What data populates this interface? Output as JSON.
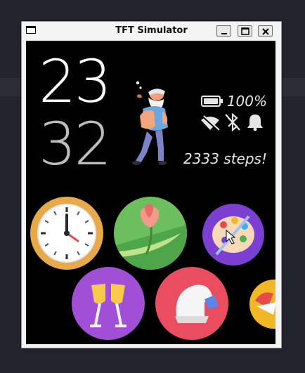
{
  "window": {
    "title": "TFT Simulator",
    "minimize_label": "minimize",
    "maximize_label": "maximize",
    "close_label": "close"
  },
  "watchface": {
    "hour": "23",
    "minute": "32",
    "battery_percent": "100%",
    "steps_text": "2333 steps!",
    "status_icons": [
      "wifi-off-icon",
      "bluetooth-off-icon",
      "bell-icon"
    ]
  },
  "apps": [
    {
      "name": "clock-app",
      "icon": "clock-icon",
      "bg": "#e7a94a"
    },
    {
      "name": "tulip-app",
      "icon": "tulip-icon",
      "bg": "#6cbf5c"
    },
    {
      "name": "paint-app",
      "icon": "palette-icon",
      "bg": "#7b3fd1"
    },
    {
      "name": "champagne-app",
      "icon": "champagne-icon",
      "bg": "#a24fd8"
    },
    {
      "name": "helmet-app",
      "icon": "helmet-icon",
      "bg": "#ea4c60"
    },
    {
      "name": "partial-app",
      "icon": "unknown-icon",
      "bg": "#f2b726"
    }
  ],
  "colors": {
    "screen_bg": "#000000",
    "hour_color": "#ffffff",
    "minute_color": "#bdbdbd",
    "desktop_bg": "#23252d"
  }
}
